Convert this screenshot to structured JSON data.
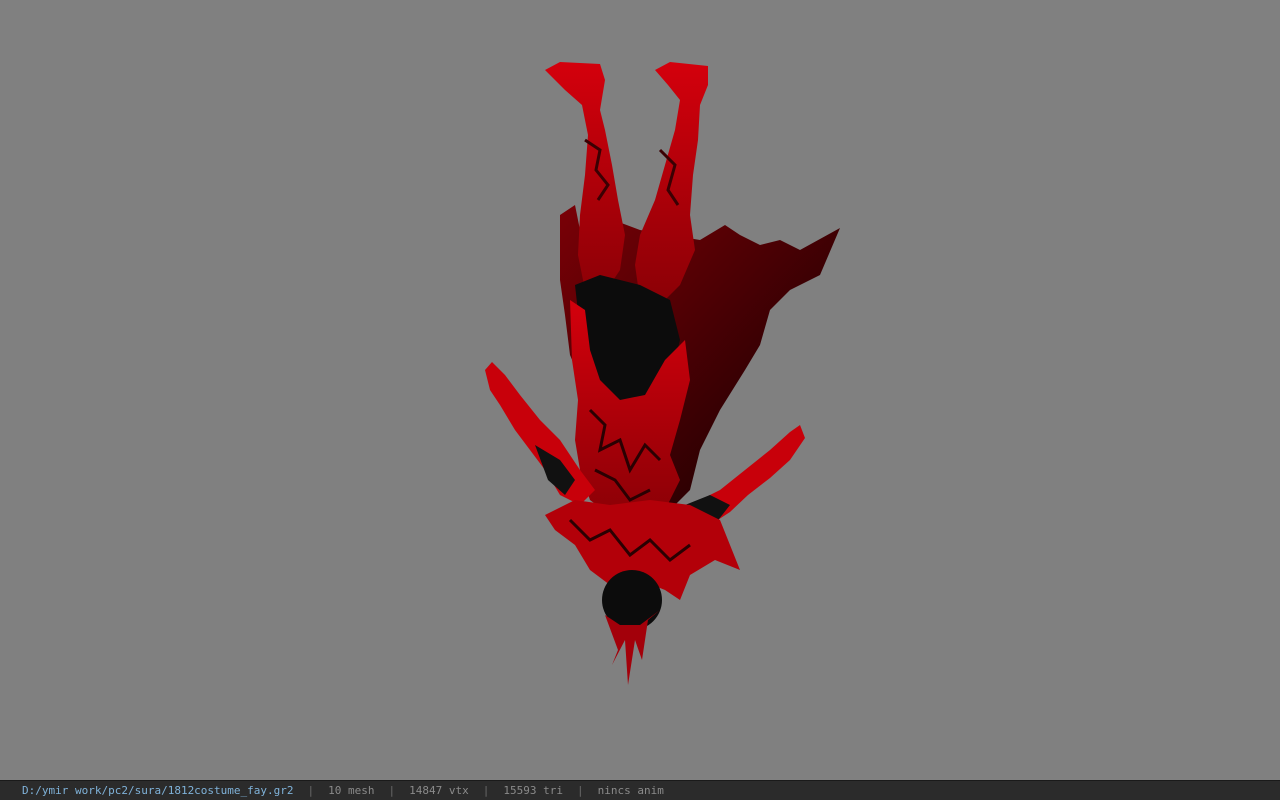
{
  "viewer": {
    "background_color": "#808080",
    "model_colors": {
      "red": "#c8000a",
      "dark_red": "#5a0004",
      "black": "#0a0a0a"
    }
  },
  "statusbar": {
    "file_path": "D:/ymir work/pc2/sura/1812costume_fay.gr2",
    "separator": "|",
    "mesh_count": "10 mesh",
    "vertex_count": "14847 vtx",
    "triangle_count": "15593 tri",
    "anim_status": "nincs anim"
  }
}
